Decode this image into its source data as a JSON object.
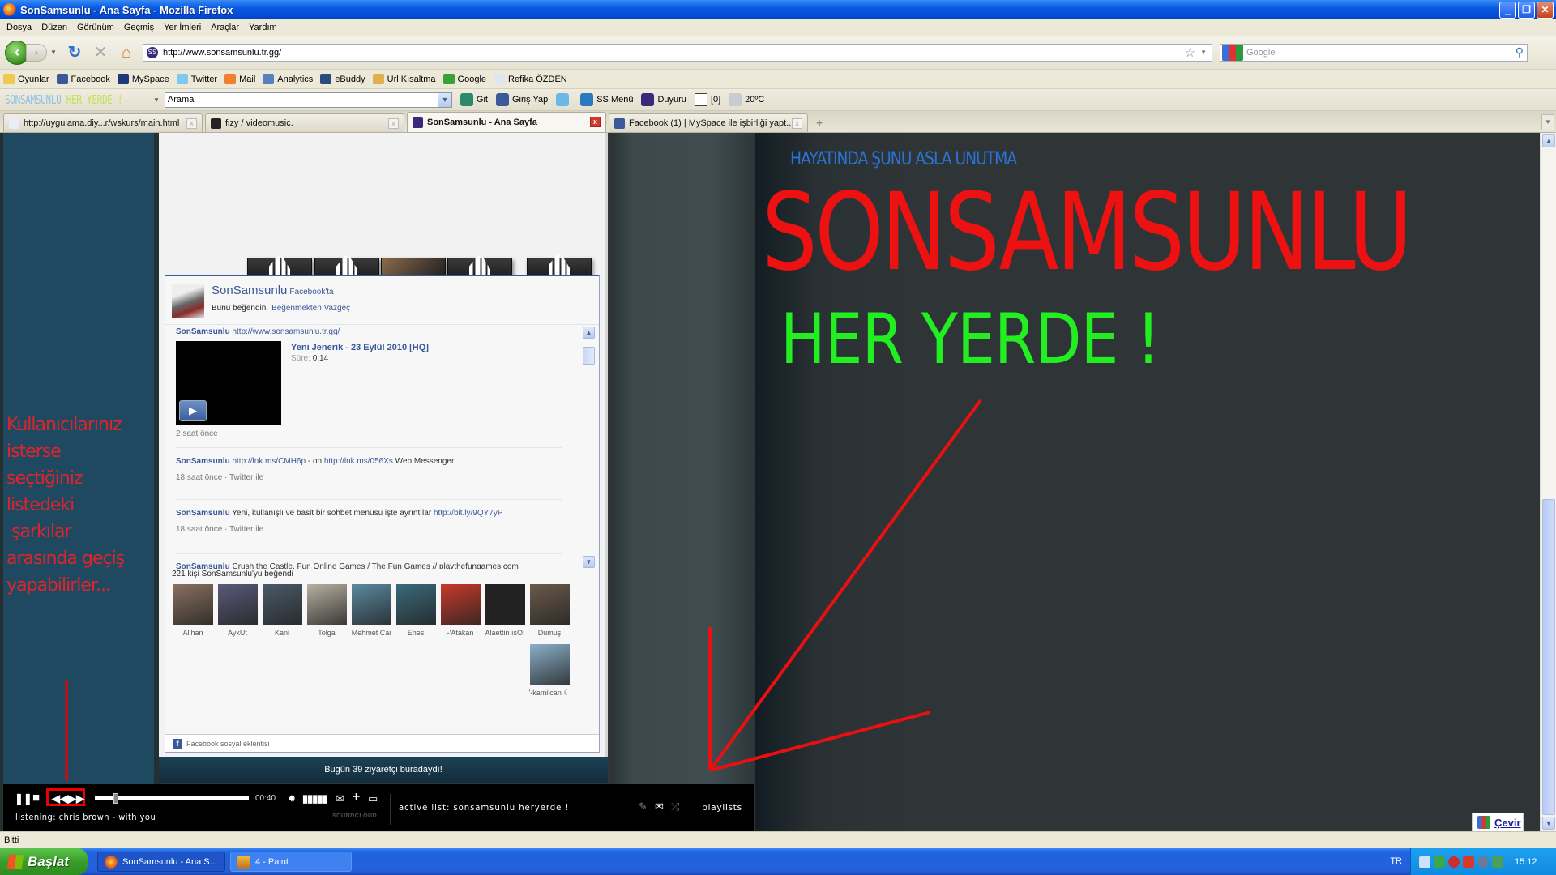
{
  "window": {
    "title": "SonSamsunlu - Ana Sayfa - Mozilla Firefox",
    "controls": {
      "minimize": "_",
      "maximize": "❐",
      "close": "✕"
    }
  },
  "menu": [
    "Dosya",
    "Düzen",
    "Görünüm",
    "Geçmiş",
    "Yer İmleri",
    "Araçlar",
    "Yardım"
  ],
  "navbar": {
    "back_icon": "back-arrow-icon",
    "url": "http://www.sonsamsunlu.tr.gg/",
    "search_placeholder": "Google"
  },
  "bookmarks": [
    {
      "label": "Oyunlar",
      "icon": "folder-icon",
      "color": "#f0c850"
    },
    {
      "label": "Facebook",
      "icon": "facebook-icon",
      "color": "#3b5998"
    },
    {
      "label": "MySpace",
      "icon": "myspace-icon",
      "color": "#1c3a7a"
    },
    {
      "label": "Twitter",
      "icon": "twitter-icon",
      "color": "#7fc8ee"
    },
    {
      "label": "Mail",
      "icon": "mail-icon",
      "color": "#f08030"
    },
    {
      "label": "Analytics",
      "icon": "analytics-icon",
      "color": "#5a7fbf"
    },
    {
      "label": "eBuddy",
      "icon": "ebuddy-icon",
      "color": "#2c4a7a"
    },
    {
      "label": "Url Kısaltma",
      "icon": "url-shortener-icon",
      "color": "#e0b050"
    },
    {
      "label": "Google",
      "icon": "google-icon",
      "color": "#3aa03a"
    },
    {
      "label": "Refika ÖZDEN",
      "icon": "page-icon",
      "color": "#dfe6f2"
    }
  ],
  "toolbar2": {
    "logo_part1": "SONSAMSUNLU",
    "logo_part2": "HER YERDE !",
    "search_value": "Arama",
    "items": [
      {
        "label": "Git",
        "icon": "go-icon",
        "color": "#2a8a6a"
      },
      {
        "label": "Giriş Yap",
        "icon": "facebook-icon",
        "color": "#3b5998"
      },
      {
        "label": "",
        "icon": "twitter-icon",
        "color": "#6ab8e8"
      },
      {
        "label": "SS Menü",
        "icon": "globe-icon",
        "color": "#2a7ac0"
      },
      {
        "label": "Duyuru",
        "icon": "ss-logo-icon",
        "color": "#3a2a7a"
      },
      {
        "label": "[0]",
        "icon": "mail-icon",
        "color": "#ffffff"
      },
      {
        "label": "20ºC",
        "icon": "weather-icon",
        "color": "#c8ccd0"
      }
    ]
  },
  "tabs": [
    {
      "label": "http://uygulama.diy...r/wskurs/main.html",
      "active": false,
      "color": "#e8eef8"
    },
    {
      "label": "fizy / videomusic.",
      "active": false,
      "color": "#222222"
    },
    {
      "label": "SonSamsunlu - Ana Sayfa",
      "active": true,
      "color": "#3a2a7a"
    },
    {
      "label": "Facebook (1) | MySpace ile işbirliği yapt...",
      "active": false,
      "color": "#3b5998"
    }
  ],
  "page": {
    "annotation_text": "Kullanıcılarınız\nisterse\nseçtiğiniz\nlistedeki\n şarkılar\narasında geçiş\nyapabilirler...",
    "tagline": "HAYATINDA ŞUNU ASLA UNUTMA",
    "headline": "SONSAMSUNLU",
    "subheadline": "HER YERDE !",
    "visitors": "Bugün 39 ziyaretçi buradaydı!",
    "colors": {
      "headline": "#ee1111",
      "subheadline": "#22ee22",
      "tagline": "#2a73d6",
      "annotation": "#e0242a"
    }
  },
  "facebook": {
    "page_name": "SonSamsunlu",
    "page_suffix": "Facebook'ta",
    "liked_text": "Bunu beğendin.",
    "unlike_link": "Beğenmekten Vazgeç",
    "posts": [
      {
        "author": "SonSamsunlu",
        "text": "",
        "link": "http://www.sonsamsunlu.tr.gg/",
        "meta": "2 saat önce",
        "video_title": "Yeni Jenerik - 23 Eylül 2010 [HQ]",
        "duration_label": "Süre:",
        "duration": "0:14"
      },
      {
        "author": "SonSamsunlu",
        "link": "http://lnk.ms/CMH6p",
        "text": " - on ",
        "link2": "http://lnk.ms/056Xs",
        "text2": " Web Messenger",
        "meta": "18 saat önce · Twitter ile"
      },
      {
        "author": "SonSamsunlu",
        "text": " Yeni, kullanışlı ve basit bir sohbet menüsü işte ayrıntılar ",
        "link": "http://bit.ly/9QY7yP",
        "meta": "18 saat önce · Twitter ile"
      },
      {
        "author": "SonSamsunlu",
        "text": " Crush the Castle, Fun Online Games / The Fun Games // playthefungames.com"
      }
    ],
    "likes_count_text": "221 kişi SonSamsunlu'yu beğendi",
    "fans": [
      {
        "name": "Alihan",
        "color": "#8a7060"
      },
      {
        "name": "AykUt",
        "color": "#5a5a7a"
      },
      {
        "name": "Kani",
        "color": "#4a5a6a"
      },
      {
        "name": "Tolga",
        "color": "#b8b0a0"
      },
      {
        "name": "Mehmet Cai",
        "color": "#5a8aa0"
      },
      {
        "name": "Enes",
        "color": "#3a6a7a"
      },
      {
        "name": "-'Atakan",
        "color": "#c83a2a"
      },
      {
        "name": "Alaettin ısO:",
        "color": "#222222"
      },
      {
        "name": "Dumuş",
        "color": "#6a5a4a"
      },
      {
        "name": "'-kamilcan ☾",
        "color": "#8ab0c8"
      }
    ],
    "footer": "Facebook sosyal eklentisi"
  },
  "player": {
    "time": "00:40",
    "progress": 0.12,
    "listening": "listening: chris brown - with you",
    "brand": "SOUNDCLOUD",
    "active_list": "active list: sonsamsunlu heryerde !",
    "playlists_label": "playlists"
  },
  "translate_button": "Çevir",
  "status": "Bitti",
  "taskbar": {
    "start": "Başlat",
    "tasks": [
      {
        "label": "SonSamsunlu - Ana S...",
        "active": true
      },
      {
        "label": "4 - Paint",
        "active": false
      }
    ],
    "language": "TR",
    "clock": "15:12"
  }
}
